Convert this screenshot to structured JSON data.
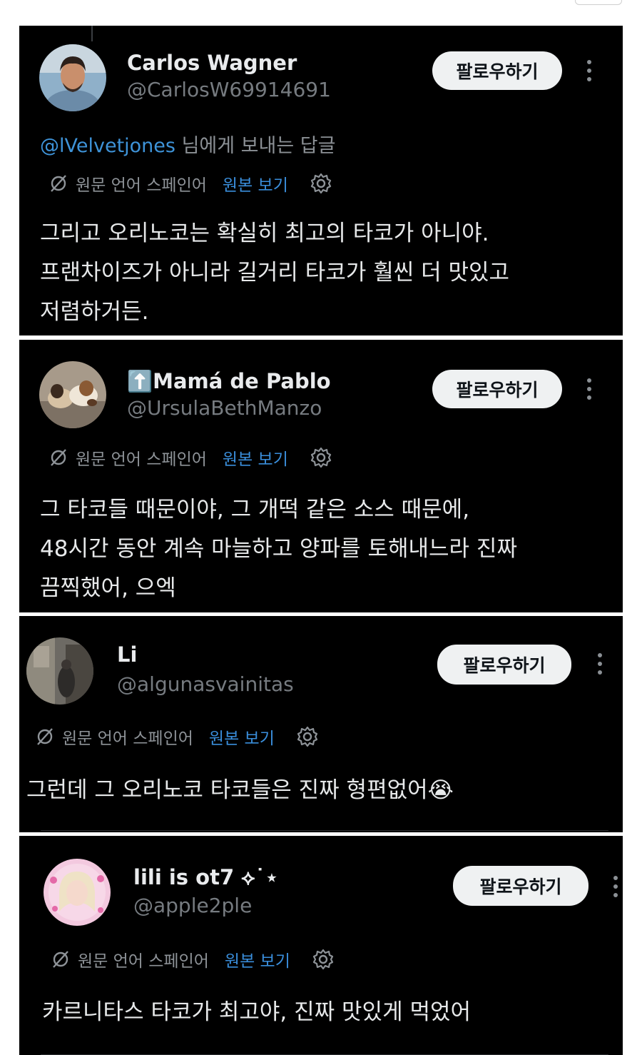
{
  "follow_label": "팔로우하기",
  "translate_label": "원문 언어 스페인어",
  "show_original_label": "원본 보기",
  "tweets": [
    {
      "name": "Carlos Wagner",
      "handle": "@CarlosW69914691",
      "reply_mention": "@lVelvetjones",
      "reply_suffix": " 님에게 보내는 답글",
      "text": "그리고 오리노코는 확실히 최고의 타코가 아니야.\n프랜차이즈가 아니라 길거리 타코가 훨씬 더 맛있고\n저렴하거든."
    },
    {
      "name": "⬆️Mamá de Pablo",
      "handle": "@UrsulaBethManzo",
      "text": "그 타코들 때문이야, 그 개떡 같은 소스 때문에,\n48시간 동안 계속 마늘하고 양파를 토해내느라 진짜\n끔찍했어, 으엑"
    },
    {
      "name": "Li",
      "handle": "@algunasvainitas",
      "text": "그런데 그 오리노코 타코들은 진짜 형편없어😭"
    },
    {
      "name": "lili is ot7 ⟡˙⋆",
      "handle": "@apple2ple",
      "text": "카르니타스 타코가 최고야, 진짜 맛있게 먹었어"
    }
  ]
}
